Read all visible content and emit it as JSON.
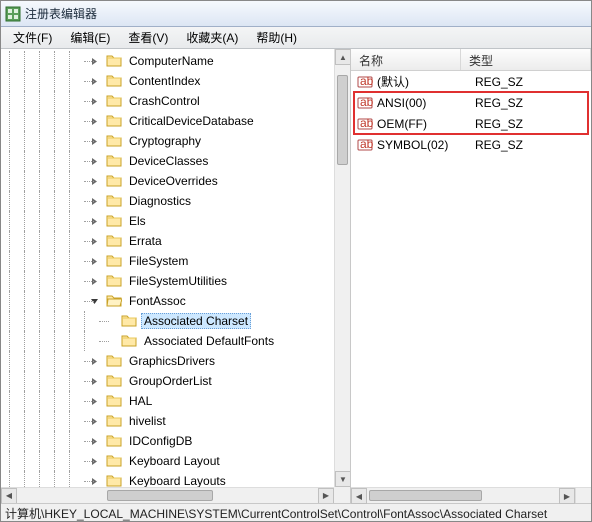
{
  "window": {
    "title": "注册表编辑器"
  },
  "menu": {
    "file": "文件(F)",
    "edit": "编辑(E)",
    "view": "查看(V)",
    "favorites": "收藏夹(A)",
    "help": "帮助(H)"
  },
  "tree": {
    "items": [
      {
        "label": "ComputerName"
      },
      {
        "label": "ContentIndex"
      },
      {
        "label": "CrashControl"
      },
      {
        "label": "CriticalDeviceDatabase"
      },
      {
        "label": "Cryptography"
      },
      {
        "label": "DeviceClasses"
      },
      {
        "label": "DeviceOverrides"
      },
      {
        "label": "Diagnostics"
      },
      {
        "label": "Els"
      },
      {
        "label": "Errata"
      },
      {
        "label": "FileSystem"
      },
      {
        "label": "FileSystemUtilities"
      },
      {
        "label": "FontAssoc",
        "expanded": true,
        "children": [
          {
            "label": "Associated Charset",
            "selected": true
          },
          {
            "label": "Associated DefaultFonts"
          }
        ]
      },
      {
        "label": "GraphicsDrivers"
      },
      {
        "label": "GroupOrderList"
      },
      {
        "label": "HAL"
      },
      {
        "label": "hivelist"
      },
      {
        "label": "IDConfigDB"
      },
      {
        "label": "Keyboard Layout"
      },
      {
        "label": "Keyboard Layouts"
      }
    ]
  },
  "list": {
    "columns": {
      "name": "名称",
      "type": "类型"
    },
    "rows": [
      {
        "name": "(默认)",
        "type": "REG_SZ"
      },
      {
        "name": "ANSI(00)",
        "type": "REG_SZ"
      },
      {
        "name": "OEM(FF)",
        "type": "REG_SZ"
      },
      {
        "name": "SYMBOL(02)",
        "type": "REG_SZ"
      }
    ]
  },
  "status": "计算机\\HKEY_LOCAL_MACHINE\\SYSTEM\\CurrentControlSet\\Control\\FontAssoc\\Associated Charset"
}
